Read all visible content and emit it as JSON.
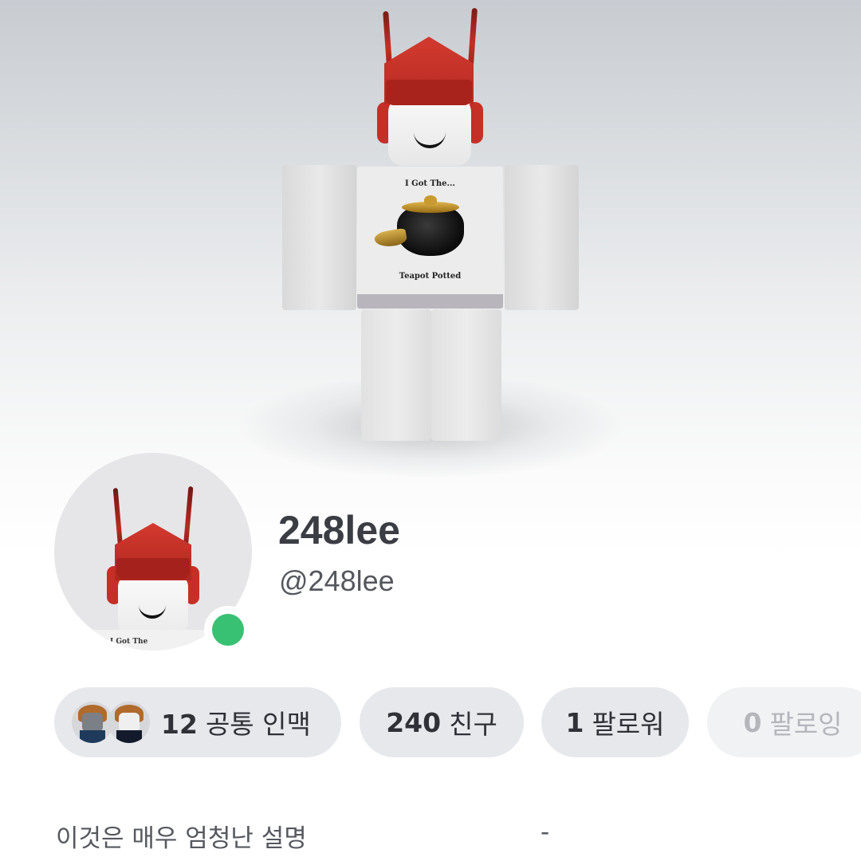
{
  "hero": {
    "shirt_text_top": "I Got The...",
    "shirt_text_bottom": "Teapot Potted"
  },
  "profile": {
    "display_name": "248lee",
    "username": "@248lee",
    "status": "online",
    "status_color": "#38c172",
    "avatar_shirt_text": "I Got The"
  },
  "stats": {
    "connections": {
      "count": "12",
      "label": "공통 인맥"
    },
    "friends": {
      "count": "240",
      "label": "친구"
    },
    "followers": {
      "count": "1",
      "label": "팔로워"
    },
    "following": {
      "count": "0",
      "label": "팔로잉"
    }
  },
  "about": {
    "description": "이것은 매우 엄청난 설명",
    "trailing": "-"
  },
  "colors": {
    "pill_bg": "#e7e8ec",
    "pill_disabled_bg": "#f1f2f4",
    "text_primary": "#3b3d44",
    "cap_red": "#c42f26"
  }
}
